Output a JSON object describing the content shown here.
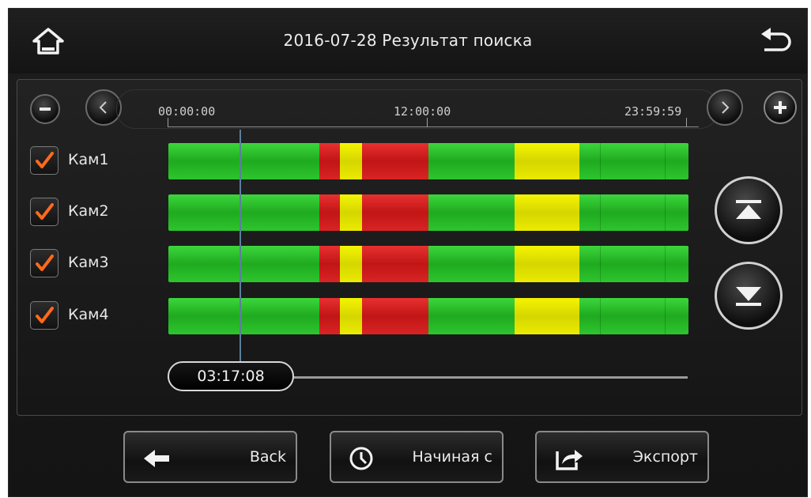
{
  "header": {
    "title": "2016-07-28  Результат поиска"
  },
  "timeline": {
    "ticks": [
      "00:00:00",
      "12:00:00",
      "23:59:59"
    ],
    "current_time": "03:17:08",
    "current_position_fraction": 0.137
  },
  "cameras": [
    {
      "label": "Кам1",
      "checked": true
    },
    {
      "label": "Кам2",
      "checked": true
    },
    {
      "label": "Кам3",
      "checked": true
    },
    {
      "label": "Кам4",
      "checked": true
    }
  ],
  "recording_segments": [
    {
      "type": "normal",
      "start_fraction": 0.0,
      "end_fraction": 0.29
    },
    {
      "type": "alarm",
      "start_fraction": 0.29,
      "end_fraction": 0.33
    },
    {
      "type": "motion",
      "start_fraction": 0.33,
      "end_fraction": 0.372
    },
    {
      "type": "alarm",
      "start_fraction": 0.372,
      "end_fraction": 0.5
    },
    {
      "type": "normal",
      "start_fraction": 0.5,
      "end_fraction": 0.665
    },
    {
      "type": "motion",
      "start_fraction": 0.665,
      "end_fraction": 0.79
    },
    {
      "type": "normal",
      "start_fraction": 0.79,
      "end_fraction": 1.0
    }
  ],
  "colors": {
    "normal": "#2ec52e",
    "alarm": "#d92424",
    "motion": "#eaea00",
    "check": "#ff6a1a",
    "background": "#181818"
  },
  "icons": {
    "home": "home-icon",
    "return": "return-arrow-icon",
    "zoom_out": "minus-icon",
    "zoom_in": "plus-icon",
    "prev": "chevron-left-icon",
    "next": "chevron-right-icon",
    "scroll_top": "scroll-to-top-icon",
    "scroll_bottom": "scroll-to-bottom-icon",
    "back": "arrow-left-icon",
    "start_from": "clock-icon",
    "export": "export-icon"
  },
  "buttons": {
    "back_label": "Back",
    "start_from_label": "Начиная с",
    "export_label": "Экспорт"
  }
}
